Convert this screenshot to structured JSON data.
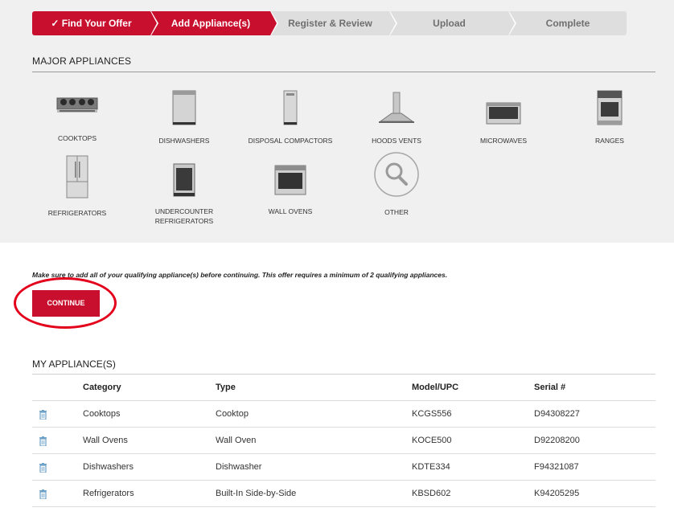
{
  "steps": [
    {
      "label": "✓ Find Your Offer",
      "state": "done"
    },
    {
      "label": "Add Appliance(s)",
      "state": "current"
    },
    {
      "label": "Register & Review",
      "state": "todo"
    },
    {
      "label": "Upload",
      "state": "todo"
    },
    {
      "label": "Complete",
      "state": "todo"
    }
  ],
  "major": {
    "title": "MAJOR APPLIANCES",
    "items": [
      {
        "label": "COOKTOPS",
        "icon": "cooktop-icon"
      },
      {
        "label": "DISHWASHERS",
        "icon": "dishwasher-icon"
      },
      {
        "label": "DISPOSAL COMPACTORS",
        "icon": "compactor-icon"
      },
      {
        "label": "HOODS VENTS",
        "icon": "hood-icon"
      },
      {
        "label": "MICROWAVES",
        "icon": "microwave-icon"
      },
      {
        "label": "RANGES",
        "icon": "range-icon"
      },
      {
        "label": "REFRIGERATORS",
        "icon": "refrigerator-icon"
      },
      {
        "label": "UNDERCOUNTER REFRIGERATORS",
        "icon": "undercounter-icon"
      },
      {
        "label": "WALL OVENS",
        "icon": "wall-oven-icon"
      },
      {
        "label": "OTHER",
        "icon": "magnifier-icon"
      }
    ]
  },
  "notice": "Make sure to add all of your qualifying appliance(s) before continuing. This offer requires a minimum of 2 qualifying appliances.",
  "continue_label": "CONTINUE",
  "my": {
    "title": "MY APPLIANCE(S)",
    "columns": [
      "Category",
      "Type",
      "Model/UPC",
      "Serial #"
    ],
    "rows": [
      {
        "category": "Cooktops",
        "type": "Cooktop",
        "model": "KCGS556",
        "serial": "D94308227"
      },
      {
        "category": "Wall Ovens",
        "type": "Wall Oven",
        "model": "KOCE500",
        "serial": "D92208200"
      },
      {
        "category": "Dishwashers",
        "type": "Dishwasher",
        "model": "KDTE334",
        "serial": "F94321087"
      },
      {
        "category": "Refrigerators",
        "type": "Built-In Side-by-Side",
        "model": "KBSD602",
        "serial": "K94205295"
      }
    ]
  },
  "colors": {
    "brand": "#c8102e",
    "step_inactive": "#dedede",
    "panel": "#f0f0f0",
    "annotation": "#e3001b"
  }
}
